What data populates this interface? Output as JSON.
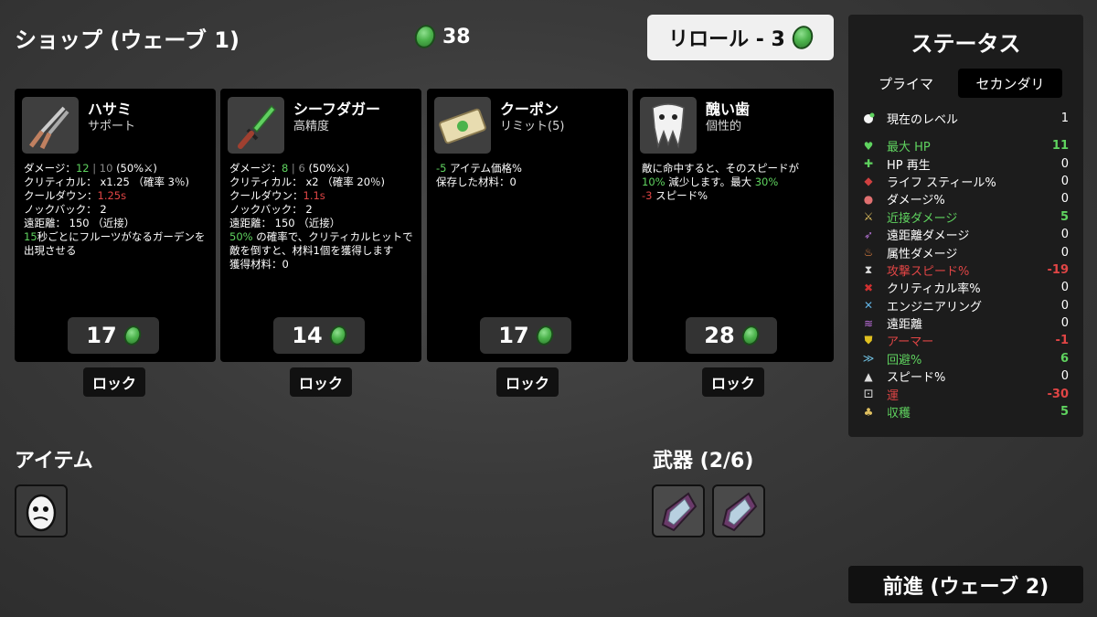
{
  "header": {
    "title": "ショップ (ウェーブ 1)",
    "coins": "38",
    "reroll_label": "リロール - 3"
  },
  "cards": [
    {
      "name": "ハサミ",
      "type": "サポート",
      "icon": "scissors-icon",
      "price": "17",
      "lock": "ロック",
      "lines": [
        {
          "parts": [
            {
              "t": "ダメージ："
            },
            {
              "t": "12",
              "c": "g"
            },
            {
              "t": " | 10 ",
              "c": "dim"
            },
            {
              "t": "(50%⚔)"
            }
          ]
        },
        {
          "parts": [
            {
              "t": "クリティカル： x1.25 （確率 3％)"
            }
          ]
        },
        {
          "parts": [
            {
              "t": "クールダウン："
            },
            {
              "t": "1.25s",
              "c": "r"
            }
          ]
        },
        {
          "parts": [
            {
              "t": "ノックバック： 2"
            }
          ]
        },
        {
          "parts": [
            {
              "t": "遠距離： 150 （近接）"
            }
          ]
        },
        {
          "wrap": true,
          "parts": [
            {
              "t": "15",
              "c": "g"
            },
            {
              "t": "秒ごとにフルーツがなるガーデンを出現させる"
            }
          ]
        }
      ]
    },
    {
      "name": "シーフダガー",
      "type": "高精度",
      "icon": "dagger-icon",
      "price": "14",
      "lock": "ロック",
      "lines": [
        {
          "parts": [
            {
              "t": "ダメージ："
            },
            {
              "t": "8",
              "c": "g"
            },
            {
              "t": " | 6 ",
              "c": "dim"
            },
            {
              "t": "(50%⚔)"
            }
          ]
        },
        {
          "parts": [
            {
              "t": "クリティカル： x2 （確率 20％)"
            }
          ]
        },
        {
          "parts": [
            {
              "t": "クールダウン："
            },
            {
              "t": "1.1s",
              "c": "r"
            }
          ]
        },
        {
          "parts": [
            {
              "t": "ノックバック： 2"
            }
          ]
        },
        {
          "parts": [
            {
              "t": "遠距離： 150 （近接）"
            }
          ]
        },
        {
          "wrap": true,
          "parts": [
            {
              "t": "50%",
              "c": "g"
            },
            {
              "t": " の確率で、クリティカルヒットで敵を倒すと、材料1個を獲得します"
            }
          ]
        },
        {
          "parts": [
            {
              "t": "獲得材料：0"
            }
          ]
        }
      ]
    },
    {
      "name": "クーポン",
      "type": "リミット(5)",
      "icon": "coupon-icon",
      "price": "17",
      "lock": "ロック",
      "lines": [
        {
          "parts": [
            {
              "t": "-5",
              "c": "g"
            },
            {
              "t": " アイテム価格%"
            }
          ]
        },
        {
          "parts": [
            {
              "t": "保存した材料：0"
            }
          ]
        }
      ]
    },
    {
      "name": "醜い歯",
      "type": "個性的",
      "icon": "ugly-tooth-icon",
      "price": "28",
      "lock": "ロック",
      "lines": [
        {
          "parts": [
            {
              "t": "敵に命中すると、そのスピードが"
            }
          ]
        },
        {
          "parts": [
            {
              "t": "10%",
              "c": "g"
            },
            {
              "t": " 減少します。最大 "
            },
            {
              "t": "30%",
              "c": "g"
            }
          ]
        },
        {
          "parts": [
            {
              "t": "-3",
              "c": "r"
            },
            {
              "t": " スピード%"
            }
          ]
        }
      ]
    }
  ],
  "items_section": {
    "title": "アイテム",
    "items": [
      "potato-face-icon"
    ]
  },
  "weapons_section": {
    "title": "武器 (2/6)",
    "weapons": [
      "crystal-weapon-icon",
      "crystal-weapon-icon"
    ]
  },
  "stats_panel": {
    "title": "ステータス",
    "tab_primary": "プライマ",
    "tab_secondary": "セカンダリ",
    "level_label": "現在のレベル",
    "level_value": "1",
    "rows": [
      {
        "icon": "heart-icon",
        "glyph": "♥",
        "label": "最大 HP",
        "value": "11",
        "color": "#5fd35f",
        "icolor": "#5fd35f"
      },
      {
        "icon": "hp-regen-icon",
        "glyph": "✚",
        "label": "HP 再生",
        "value": "0",
        "color": "#ffffff",
        "icolor": "#5fd35f"
      },
      {
        "icon": "life-steal-icon",
        "glyph": "◆",
        "label": "ライフ スティール%",
        "value": "0",
        "color": "#ffffff",
        "icolor": "#d04040"
      },
      {
        "icon": "damage-icon",
        "glyph": "●",
        "label": "ダメージ%",
        "value": "0",
        "color": "#ffffff",
        "icolor": "#e07070"
      },
      {
        "icon": "melee-damage-icon",
        "glyph": "⚔",
        "label": "近接ダメージ",
        "value": "5",
        "color": "#5fd35f",
        "icolor": "#e0c060"
      },
      {
        "icon": "ranged-damage-icon",
        "glyph": "➶",
        "label": "遠距離ダメージ",
        "value": "0",
        "color": "#ffffff",
        "icolor": "#b070d0"
      },
      {
        "icon": "elemental-damage-icon",
        "glyph": "♨",
        "label": "属性ダメージ",
        "value": "0",
        "color": "#ffffff",
        "icolor": "#e08040"
      },
      {
        "icon": "attack-speed-icon",
        "glyph": "⧗",
        "label": "攻撃スピード%",
        "value": "-19",
        "color": "#e04545",
        "icolor": "#dddddd"
      },
      {
        "icon": "crit-chance-icon",
        "glyph": "✖",
        "label": "クリティカル率%",
        "value": "0",
        "color": "#ffffff",
        "icolor": "#d03030"
      },
      {
        "icon": "engineering-icon",
        "glyph": "✕",
        "label": "エンジニアリング",
        "value": "0",
        "color": "#ffffff",
        "icolor": "#60b0e0"
      },
      {
        "icon": "range-icon",
        "glyph": "≋",
        "label": "遠距離",
        "value": "0",
        "color": "#ffffff",
        "icolor": "#c070e0"
      },
      {
        "icon": "armor-icon",
        "glyph": "⛊",
        "label": "アーマー",
        "value": "-1",
        "color": "#e04545",
        "icolor": "#e0c020"
      },
      {
        "icon": "dodge-icon",
        "glyph": "≫",
        "label": "回避%",
        "value": "6",
        "color": "#5fd35f",
        "icolor": "#70c0e0"
      },
      {
        "icon": "speed-icon",
        "glyph": "▲",
        "label": "スピード%",
        "value": "0",
        "color": "#ffffff",
        "icolor": "#dddddd"
      },
      {
        "icon": "luck-icon",
        "glyph": "⚀",
        "label": "運",
        "value": "-30",
        "color": "#e04545",
        "icolor": "#dddddd"
      },
      {
        "icon": "harvesting-icon",
        "glyph": "♣",
        "label": "収穫",
        "value": "5",
        "color": "#5fd35f",
        "icolor": "#e0c060"
      }
    ]
  },
  "next_button": "前進 (ウェーブ 2)"
}
